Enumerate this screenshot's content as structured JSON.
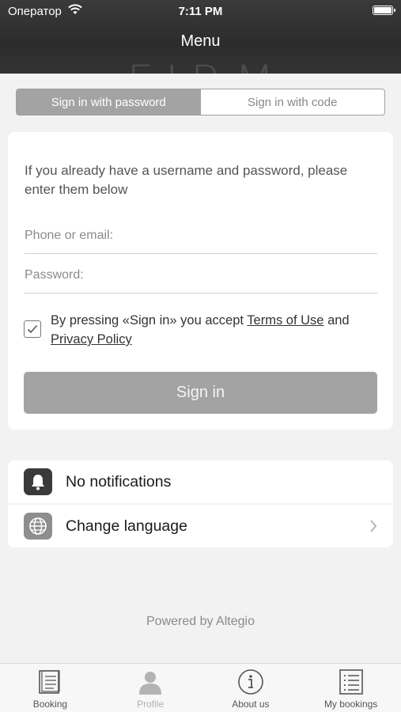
{
  "status_bar": {
    "carrier": "Оператор",
    "time": "7:11 PM"
  },
  "header": {
    "title": "Menu",
    "background_text": "FIRM"
  },
  "segmented_control": {
    "options": [
      {
        "label": "Sign in with password",
        "active": true
      },
      {
        "label": "Sign in with code",
        "active": false
      }
    ]
  },
  "login_form": {
    "intro_text": "If you already have a username and password, please enter them below",
    "phone_placeholder": "Phone or email:",
    "phone_value": "",
    "password_placeholder": "Password:",
    "password_value": "",
    "consent_checked": true,
    "consent_prefix": "By pressing «Sign in» you accept",
    "terms_link": "Terms of Use",
    "consent_and": "and",
    "privacy_link": "Privacy Policy",
    "submit_label": "Sign in"
  },
  "settings_list": [
    {
      "label": "No notifications",
      "icon": "bell-icon"
    },
    {
      "label": "Change language",
      "icon": "globe-icon"
    }
  ],
  "footer": {
    "powered_by": "Powered by Altegio"
  },
  "tab_bar": {
    "tabs": [
      {
        "label": "Booking",
        "icon": "book-icon"
      },
      {
        "label": "Profile",
        "icon": "person-icon"
      },
      {
        "label": "About us",
        "icon": "info-icon"
      },
      {
        "label": "My bookings",
        "icon": "list-icon"
      }
    ]
  },
  "colors": {
    "header_bg": "#2e2e2e",
    "active_segment": "#a3a3a3",
    "button_bg": "#a3a3a3",
    "page_bg": "#f2f2f2"
  }
}
